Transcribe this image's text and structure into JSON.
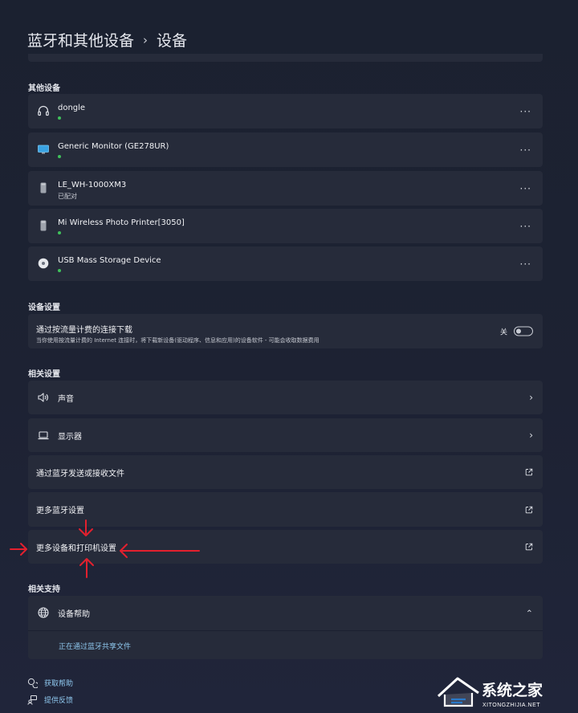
{
  "breadcrumb": {
    "parent": "蓝牙和其他设备",
    "separator": "›",
    "current": "设备"
  },
  "sections": {
    "other_devices": "其他设备",
    "device_settings": "设备设置",
    "related_settings": "相关设置",
    "related_support": "相关支持"
  },
  "devices": [
    {
      "name": "dongle",
      "status": "",
      "icon": "headphones-icon",
      "more": "···"
    },
    {
      "name": "Generic Monitor (GE278UR)",
      "status": "",
      "icon": "monitor-icon",
      "more": "···"
    },
    {
      "name": "LE_WH-1000XM3",
      "status": "已配对",
      "icon": "generic-device-icon",
      "more": "···"
    },
    {
      "name": "Mi Wireless Photo Printer[3050]",
      "status": "",
      "icon": "generic-device-icon",
      "more": "···"
    },
    {
      "name": "USB Mass Storage Device",
      "status": "",
      "icon": "usb-drive-icon",
      "more": "···"
    }
  ],
  "metered": {
    "title": "通过按流量计费的连接下载",
    "description": "当你使用按流量计费的 Internet 连接时，将下载新设备(驱动程序、信息和应用)的设备软件 - 可能会收取数据费用",
    "toggle_label": "关",
    "toggle_on": false
  },
  "related": [
    {
      "label": "声音",
      "icon": "speaker-icon",
      "action": "chevron"
    },
    {
      "label": "显示器",
      "icon": "laptop-icon",
      "action": "chevron"
    },
    {
      "label": "通过蓝牙发送或接收文件",
      "icon": "",
      "action": "external"
    },
    {
      "label": "更多蓝牙设置",
      "icon": "",
      "action": "external"
    },
    {
      "label": "更多设备和打印机设置",
      "icon": "",
      "action": "external"
    }
  ],
  "support": {
    "title": "设备帮助",
    "link": "正在通过蓝牙共享文件"
  },
  "footer": {
    "get_help": "获取帮助",
    "feedback": "提供反馈"
  },
  "watermark": {
    "brand": "系统之家",
    "url": "XITONGZHIJIA.NET"
  },
  "colors": {
    "accent_link": "#8fc8ef",
    "status_dot": "#3fc15b",
    "annotation_arrow": "#e3202e"
  }
}
